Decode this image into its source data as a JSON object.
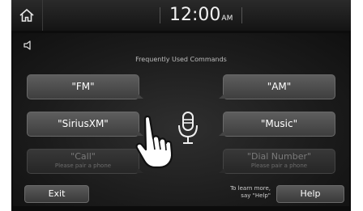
{
  "header": {
    "time": "12:00",
    "ampm": "AM",
    "home_icon": "home-icon"
  },
  "main": {
    "speaker_icon": "speaker-icon",
    "title": "Frequently Used Commands",
    "commands": [
      {
        "label": "\"FM\"",
        "enabled": true
      },
      {
        "label": "\"AM\"",
        "enabled": true
      },
      {
        "label": "\"SiriusXM\"",
        "enabled": true
      },
      {
        "label": "\"Music\"",
        "enabled": true
      },
      {
        "label": "\"Call\"",
        "sub": "Please pair a phone",
        "enabled": false
      },
      {
        "label": "\"Dial Number\"",
        "sub": "Please pair a phone",
        "enabled": false
      }
    ],
    "mic_icon": "microphone-icon",
    "hand_icon": "pointing-hand-icon"
  },
  "footer": {
    "exit_label": "Exit",
    "learn_line1": "To learn more,",
    "learn_line2": "say \"Help\"",
    "help_label": "Help"
  }
}
